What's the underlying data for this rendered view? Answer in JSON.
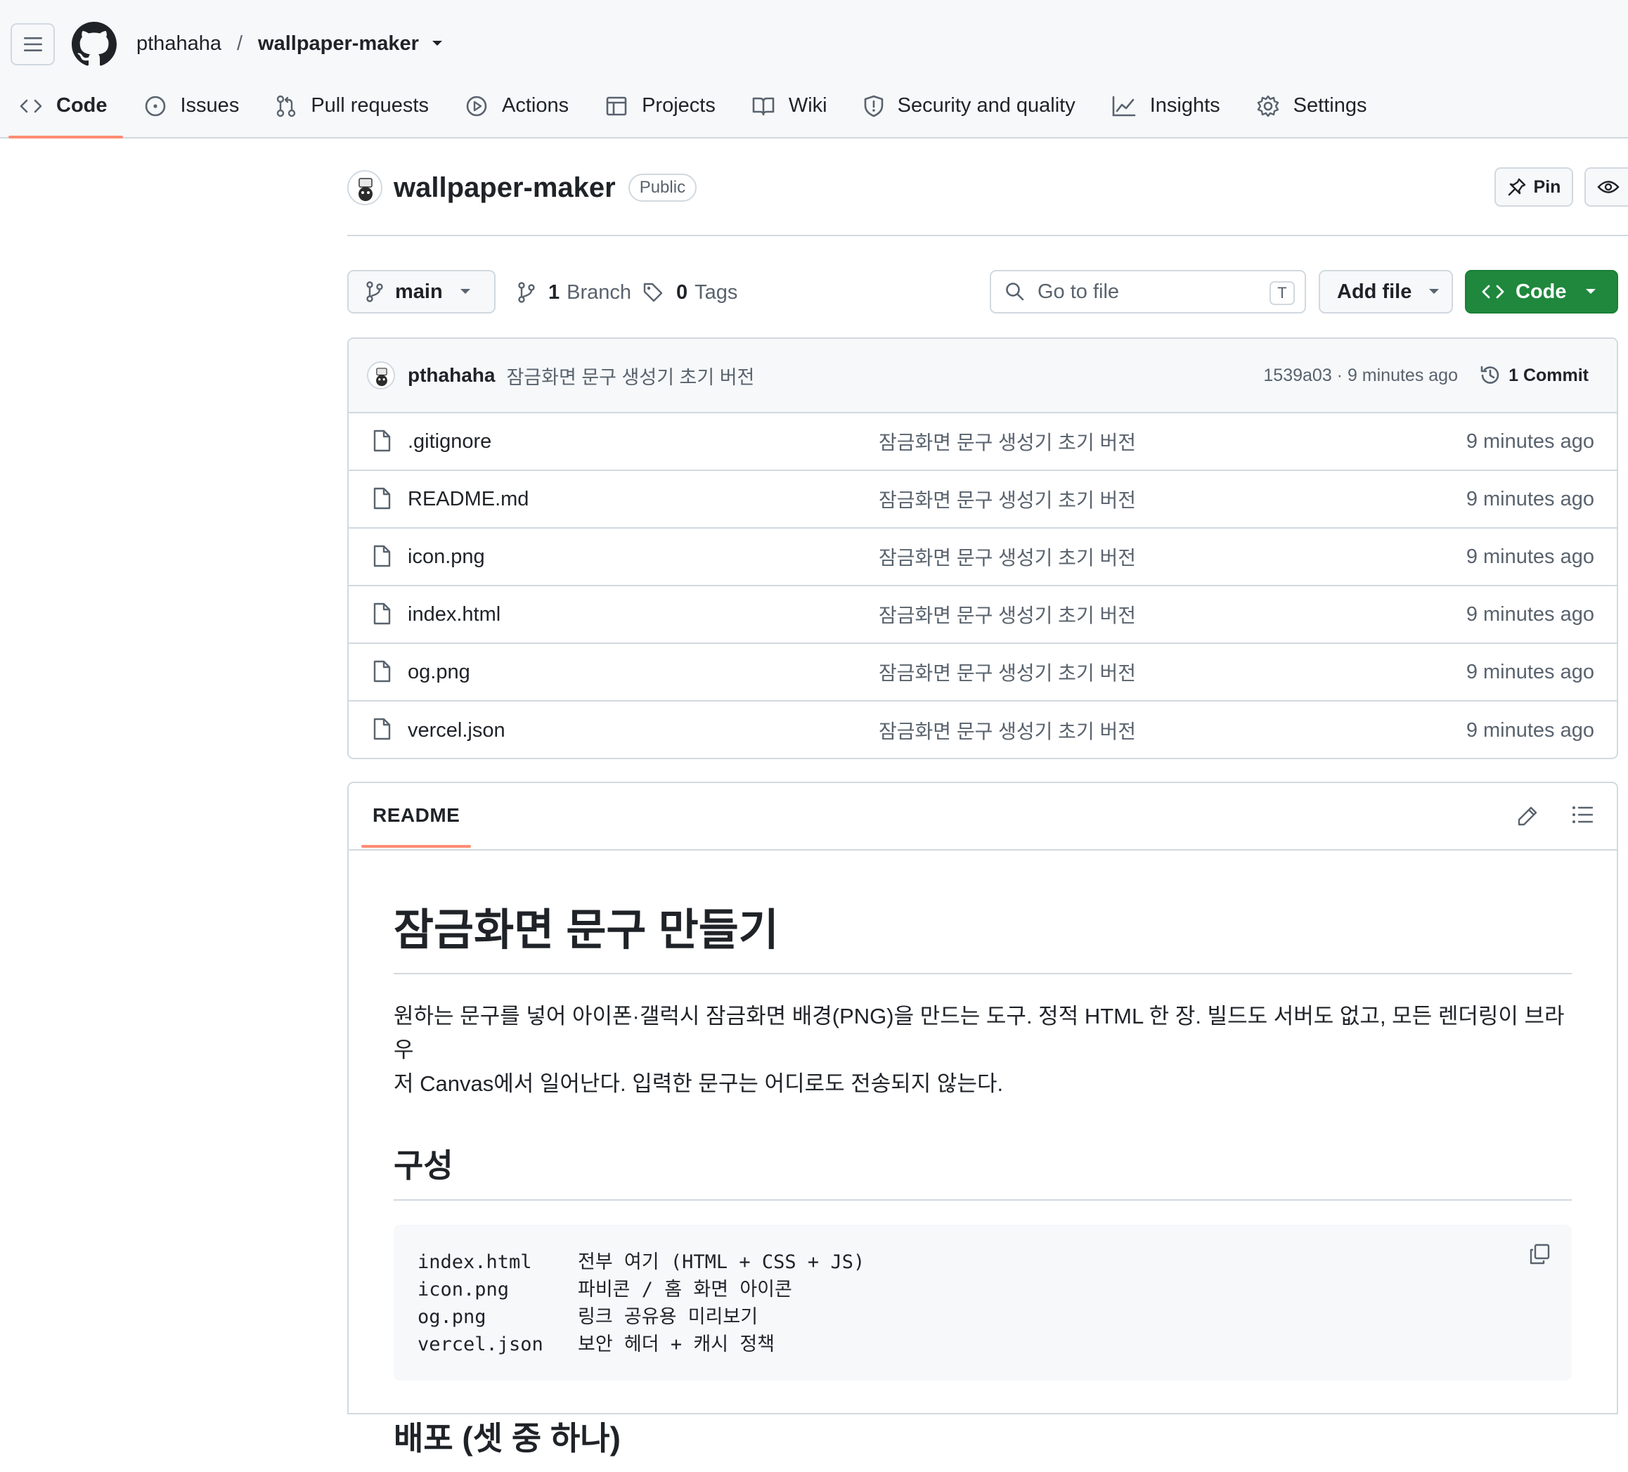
{
  "header": {
    "owner": "pthahaha",
    "separator": "/",
    "repo": "wallpaper-maker"
  },
  "tabs": [
    {
      "label": "Code",
      "icon": "code-icon",
      "active": true
    },
    {
      "label": "Issues",
      "icon": "issue-icon"
    },
    {
      "label": "Pull requests",
      "icon": "pull-request-icon"
    },
    {
      "label": "Actions",
      "icon": "play-icon"
    },
    {
      "label": "Projects",
      "icon": "table-icon"
    },
    {
      "label": "Wiki",
      "icon": "book-icon"
    },
    {
      "label": "Security and quality",
      "icon": "shield-icon"
    },
    {
      "label": "Insights",
      "icon": "graph-icon"
    },
    {
      "label": "Settings",
      "icon": "gear-icon"
    }
  ],
  "repo_head": {
    "title": "wallpaper-maker",
    "visibility": "Public",
    "pin_label": "Pin"
  },
  "toolbar": {
    "branch": "main",
    "branch_count": "1",
    "branch_word": "Branch",
    "tag_count": "0",
    "tag_word": "Tags",
    "search_placeholder": "Go to file",
    "search_shortcut": "T",
    "add_file_label": "Add file",
    "code_label": "Code"
  },
  "commit": {
    "author": "pthahaha",
    "message": "잠금화면 문구 생성기 초기 버전",
    "meta": "1539a03 · 9 minutes ago",
    "count_label": "1 Commit"
  },
  "files": [
    {
      "name": ".gitignore",
      "message": "잠금화면 문구 생성기 초기 버전",
      "date": "9 minutes ago"
    },
    {
      "name": "README.md",
      "message": "잠금화면 문구 생성기 초기 버전",
      "date": "9 minutes ago"
    },
    {
      "name": "icon.png",
      "message": "잠금화면 문구 생성기 초기 버전",
      "date": "9 minutes ago"
    },
    {
      "name": "index.html",
      "message": "잠금화면 문구 생성기 초기 버전",
      "date": "9 minutes ago"
    },
    {
      "name": "og.png",
      "message": "잠금화면 문구 생성기 초기 버전",
      "date": "9 minutes ago"
    },
    {
      "name": "vercel.json",
      "message": "잠금화면 문구 생성기 초기 버전",
      "date": "9 minutes ago"
    }
  ],
  "readme": {
    "tab_label": "README",
    "h1": "잠금화면 문구 만들기",
    "intro_line1": "원하는 문구를 넣어 아이폰·갤럭시 잠금화면 배경(PNG)을 만드는 도구. 정적 HTML 한 장. 빌드도 서버도 없고, 모든 렌더링이 브라우",
    "intro_line2": "저 Canvas에서 일어난다. 입력한 문구는 어디로도 전송되지 않는다.",
    "h2_structure": "구성",
    "code_lines": [
      {
        "file": "index.html",
        "desc": "전부 여기 (HTML + CSS + JS)"
      },
      {
        "file": "icon.png",
        "desc": "파비콘 / 홈 화면 아이콘"
      },
      {
        "file": "og.png",
        "desc": "링크 공유용 미리보기"
      },
      {
        "file": "vercel.json",
        "desc": "보안 헤더 + 캐시 정책"
      }
    ],
    "h2_deploy": "배포 (셋 중 하나)"
  },
  "colors": {
    "accent_underline": "#fd8c73",
    "code_button": "#1f883d",
    "border": "#d1d9e0",
    "muted_text": "#59636e"
  }
}
